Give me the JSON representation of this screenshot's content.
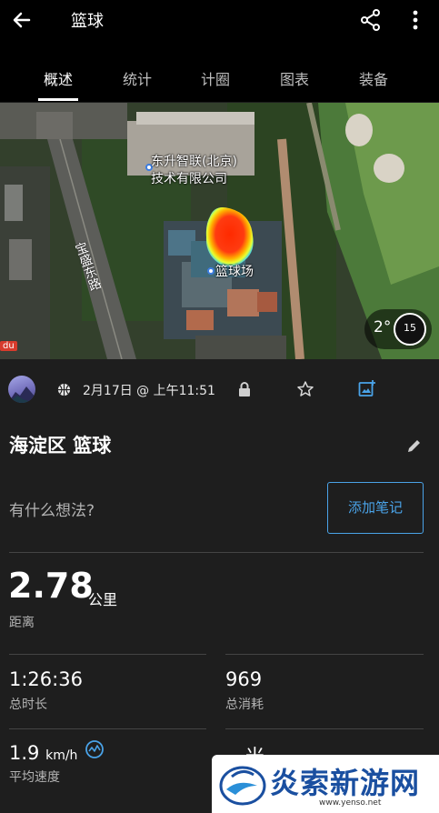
{
  "appbar": {
    "title": "篮球"
  },
  "tabs": [
    {
      "label": "概述",
      "active": true
    },
    {
      "label": "统计",
      "active": false
    },
    {
      "label": "计圈",
      "active": false
    },
    {
      "label": "图表",
      "active": false
    },
    {
      "label": "装备",
      "active": false
    }
  ],
  "map": {
    "poi_line1": "东升智联(北京)",
    "poi_line2": "技术有限公司",
    "road": "宝盛东路",
    "court": "篮球场",
    "weather_temp": "2°",
    "weather_dial": "15",
    "baidu_logo": "du"
  },
  "activity": {
    "date": "2月17日 @ 上午11:51",
    "title": "海淀区 篮球",
    "thought_placeholder": "有什么想法?",
    "add_note_label": "添加笔记"
  },
  "stats": {
    "distance": {
      "value": "2.78",
      "unit": "公里",
      "label": "距离"
    },
    "total_time": {
      "value": "1:26:36",
      "label": "总时长"
    },
    "total_calories": {
      "value": "969",
      "label": "总消耗"
    },
    "avg_speed": {
      "value": "1.9",
      "unit": "km/h",
      "label": "平均速度"
    },
    "partial_value": "-- 米"
  },
  "watermark": {
    "text": "炎索新游网",
    "url": "www.yenso.net"
  },
  "colors": {
    "accent": "#4aa3e8",
    "background": "#1e1e1e",
    "bar": "#000000"
  }
}
